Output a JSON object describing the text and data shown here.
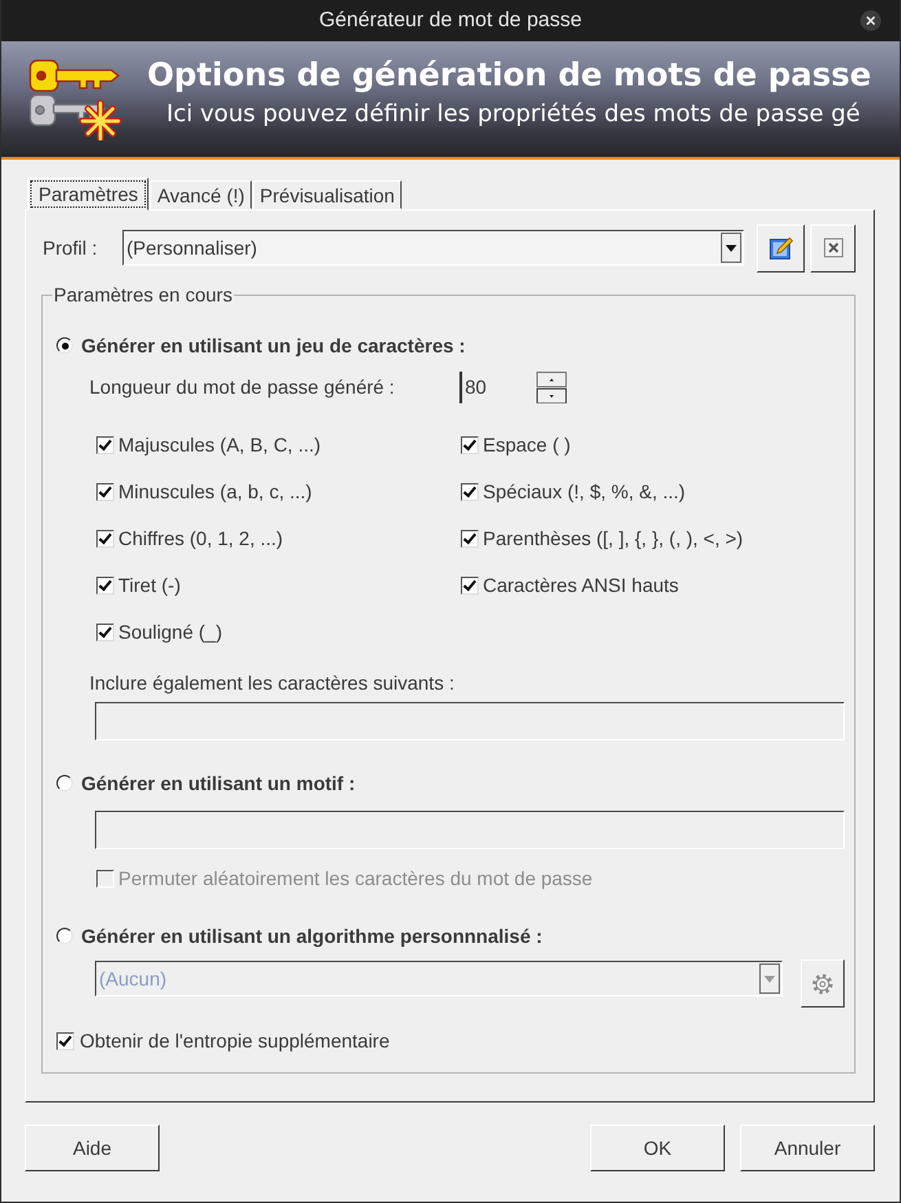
{
  "window": {
    "title": "Générateur de mot de passe"
  },
  "banner": {
    "title": "Options de génération de mots de passe",
    "subtitle": "Ici vous pouvez définir les propriétés des mots de passe gé"
  },
  "tabs": [
    {
      "label": "Paramètres",
      "selected": true
    },
    {
      "label": "Avancé (!)",
      "selected": false
    },
    {
      "label": "Prévisualisation",
      "selected": false
    }
  ],
  "profile": {
    "label": "Profil :",
    "value": "(Personnaliser)"
  },
  "settings": {
    "title": "Paramètres en cours",
    "modes": [
      {
        "kind": "charset",
        "label": "Générer en utilisant un jeu de caractères :",
        "selected": true,
        "length": {
          "label": "Longueur du mot de passe généré :",
          "value": "80"
        },
        "character_sets": [
          {
            "label": "Majuscules (A, B, C, ...)",
            "checked": true
          },
          {
            "label": "Espace ( )",
            "checked": true
          },
          {
            "label": "Minuscules (a, b, c, ...)",
            "checked": true
          },
          {
            "label": "Spéciaux (!, $, %, &, ...)",
            "checked": true
          },
          {
            "label": "Chiffres (0, 1, 2, ...)",
            "checked": true
          },
          {
            "label": "Parenthèses ([, ], {, }, (, ), <, >)",
            "checked": true
          },
          {
            "label": "Tiret (-)",
            "checked": true
          },
          {
            "label": "Caractères ANSI hauts",
            "checked": true
          },
          {
            "label": "Souligné (_)",
            "checked": true
          }
        ],
        "include": {
          "label": "Inclure également les caractères suivants :"
        }
      },
      {
        "kind": "pattern",
        "label": "Générer en utilisant un motif :",
        "selected": false,
        "shuffle": {
          "label": "Permuter aléatoirement les caractères du mot de passe",
          "checked": false,
          "disabled": true
        }
      },
      {
        "kind": "algorithm",
        "label": "Générer en utilisant un algorithme personnnalisé :",
        "selected": false,
        "algorithm": {
          "value": "(Aucun)",
          "disabled": true
        }
      }
    ],
    "extra_entropy": {
      "label": "Obtenir de l'entropie supplémentaire",
      "checked": true
    }
  },
  "buttons": [
    {
      "kind": "help",
      "label": "Aide"
    },
    {
      "kind": "ok",
      "label": "OK"
    },
    {
      "kind": "cancel",
      "label": "Annuler"
    }
  ]
}
